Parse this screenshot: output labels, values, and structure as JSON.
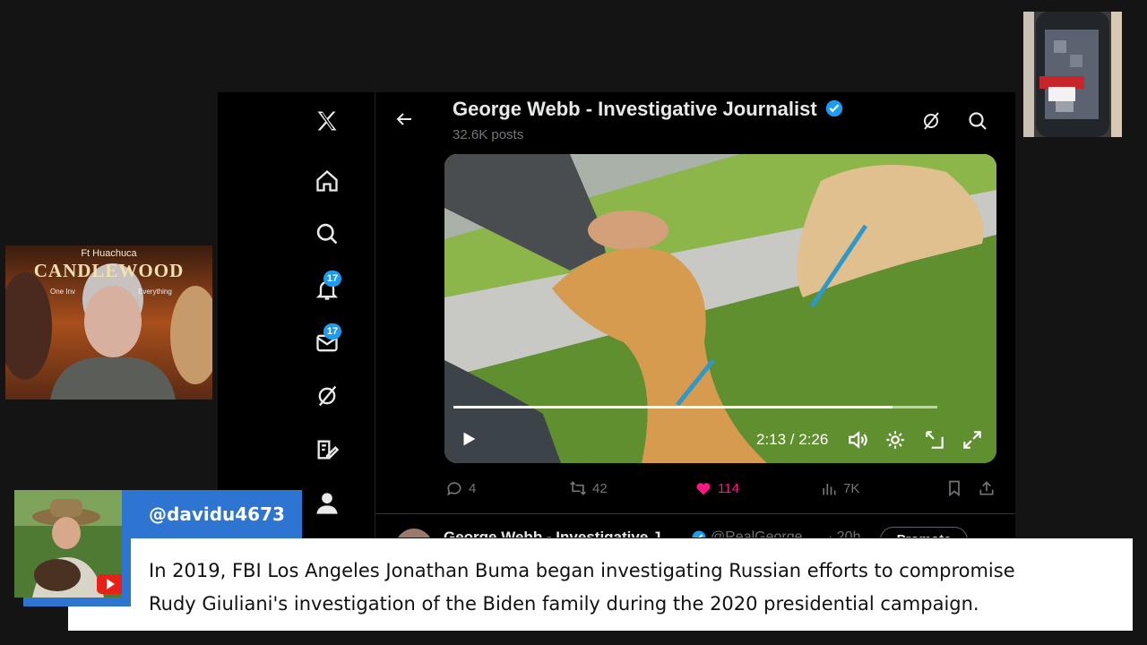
{
  "profile": {
    "title": "George Webb - Investigative Journalist",
    "posts": "32.6K posts",
    "verified_color": "#1d9bf0"
  },
  "sidebar": {
    "items": [
      {
        "icon": "x-logo-icon"
      },
      {
        "icon": "home-icon"
      },
      {
        "icon": "search-icon"
      },
      {
        "icon": "notifications-icon",
        "badge": "17"
      },
      {
        "icon": "messages-icon",
        "badge": "17"
      },
      {
        "icon": "grok-icon"
      },
      {
        "icon": "compose-icon"
      },
      {
        "icon": "profile-icon"
      }
    ]
  },
  "video": {
    "time": "2:13 / 2:26",
    "progress": 0.91
  },
  "actions": {
    "replies": "4",
    "reposts": "42",
    "likes": "114",
    "views": "7K",
    "like_color": "#f91880"
  },
  "next_post": {
    "author": "George Webb - Investigative J...",
    "handle": "@RealGeorge...",
    "time": "· 20h",
    "promote": "Promote"
  },
  "stream": {
    "cam_text_1": "Ft Huachuca",
    "cam_text_2": "CANDLEWOOD",
    "cam_text_3": "One Inv",
    "cam_text_4": "Everything",
    "handle": "@davidu4673",
    "caption_line1": "In 2019, FBI Los Angeles Jonathan Buma began investigating Russian efforts to compromise",
    "caption_line2": "Rudy Giuliani's investigation of the Biden family during the 2020 presidential campaign."
  }
}
